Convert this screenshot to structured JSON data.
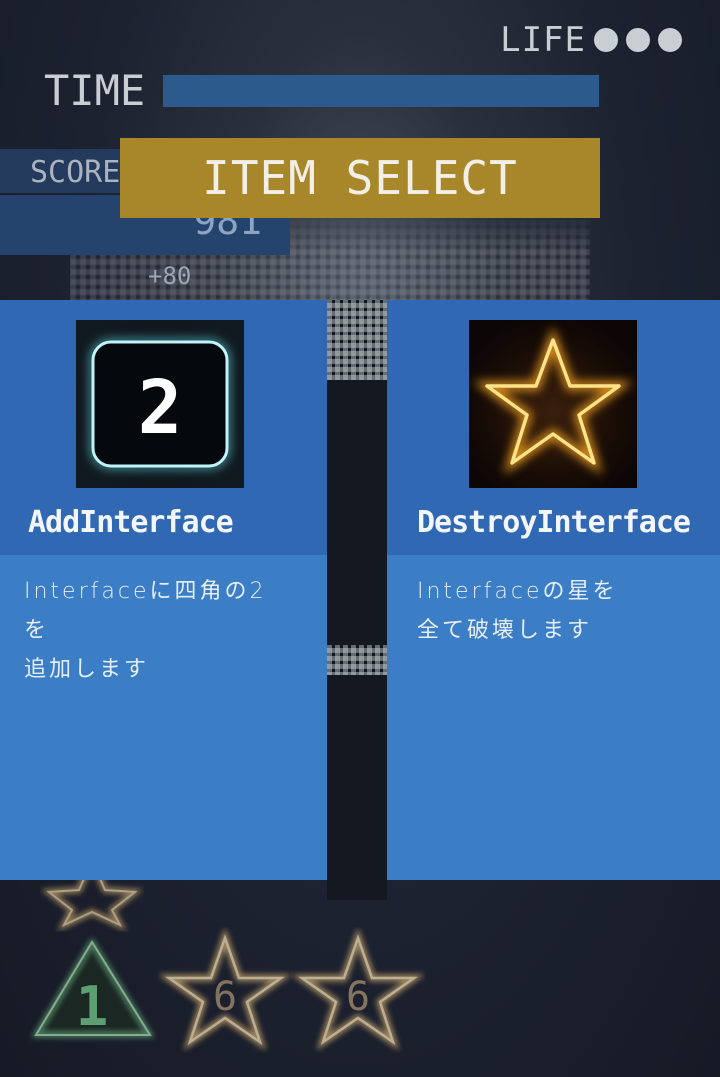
{
  "hud": {
    "life_label": "LIFE",
    "life_count": 3,
    "time_label": "TIME",
    "time_remaining_fraction": 1.0,
    "score_label": "SCORE",
    "score_value": "981",
    "score_bonus": "+80"
  },
  "dialog": {
    "title": "ITEM SELECT"
  },
  "items": [
    {
      "title": "AddInterface",
      "icon": "square-2-icon",
      "icon_glyph": "2",
      "description": "Interfaceに四角の2\nを\n追加します"
    },
    {
      "title": "DestroyInterface",
      "icon": "star-icon",
      "description": "Interfaceの星を\n全て破壊します"
    }
  ],
  "board": {
    "pieces": [
      {
        "shape": "star",
        "label": ""
      },
      {
        "shape": "triangle",
        "label": "1"
      },
      {
        "shape": "star",
        "label": "6"
      },
      {
        "shape": "star",
        "label": "6"
      }
    ]
  },
  "colors": {
    "accent_gold": "#a8862a",
    "card_blue": "#3b7ec6",
    "card_head_blue": "#3068b4",
    "time_bar": "#2d5a8c",
    "star_glow": "#f0a020",
    "square_glow": "#7fe0e8"
  }
}
